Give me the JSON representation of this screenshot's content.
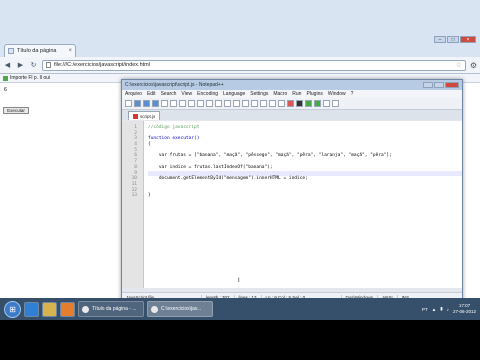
{
  "browser": {
    "tab_title": "Título da página",
    "address": "file:///C:/exercicios/javascript/index.html",
    "bookmark_label": "Importe Fl p. Il oui"
  },
  "page": {
    "result_text": "6",
    "button_label": "Executar"
  },
  "notepad": {
    "title": "C:\\exercicios\\javascript\\script.js - Notepad++",
    "menu": [
      "Arquivo",
      "Edit",
      "Search",
      "View",
      "Encoding",
      "Language",
      "Settings",
      "Macro",
      "Run",
      "Plugins",
      "Window",
      "?"
    ],
    "tab_label": "script.js",
    "line_numbers": [
      "1",
      "2",
      "3",
      "4",
      "5",
      "6",
      "7",
      "8",
      "9",
      "10",
      "11",
      "12",
      "13"
    ],
    "code_lines": [
      "//código javascript",
      "",
      "function executar()",
      "{",
      "",
      "    var frutas = [\"banana\", \"maçã\", \"pêssego\", \"maçã\", \"pêra\", \"laranja\", \"maçã\", \"pêra\"];",
      "",
      "    var indice = frutas.lastIndexOf(\"banana\");",
      "",
      "    document.getElementById(\"mensagem\").innerHTML = indice;",
      "",
      "",
      "}"
    ],
    "status": {
      "language": "JavaScript file",
      "length": "length : 302",
      "lines": "lines : 13",
      "position": "Ln : 9    Col : 5    Sel : 0",
      "eol": "Dos\\Windows",
      "encoding": "ANSI",
      "mode": "INS"
    }
  },
  "taskbar": {
    "tasks": [
      "Título da página - ...",
      "C:\\exercicios\\jav..."
    ],
    "language": "PT",
    "time": "17:07",
    "date": "27-06-2012"
  }
}
